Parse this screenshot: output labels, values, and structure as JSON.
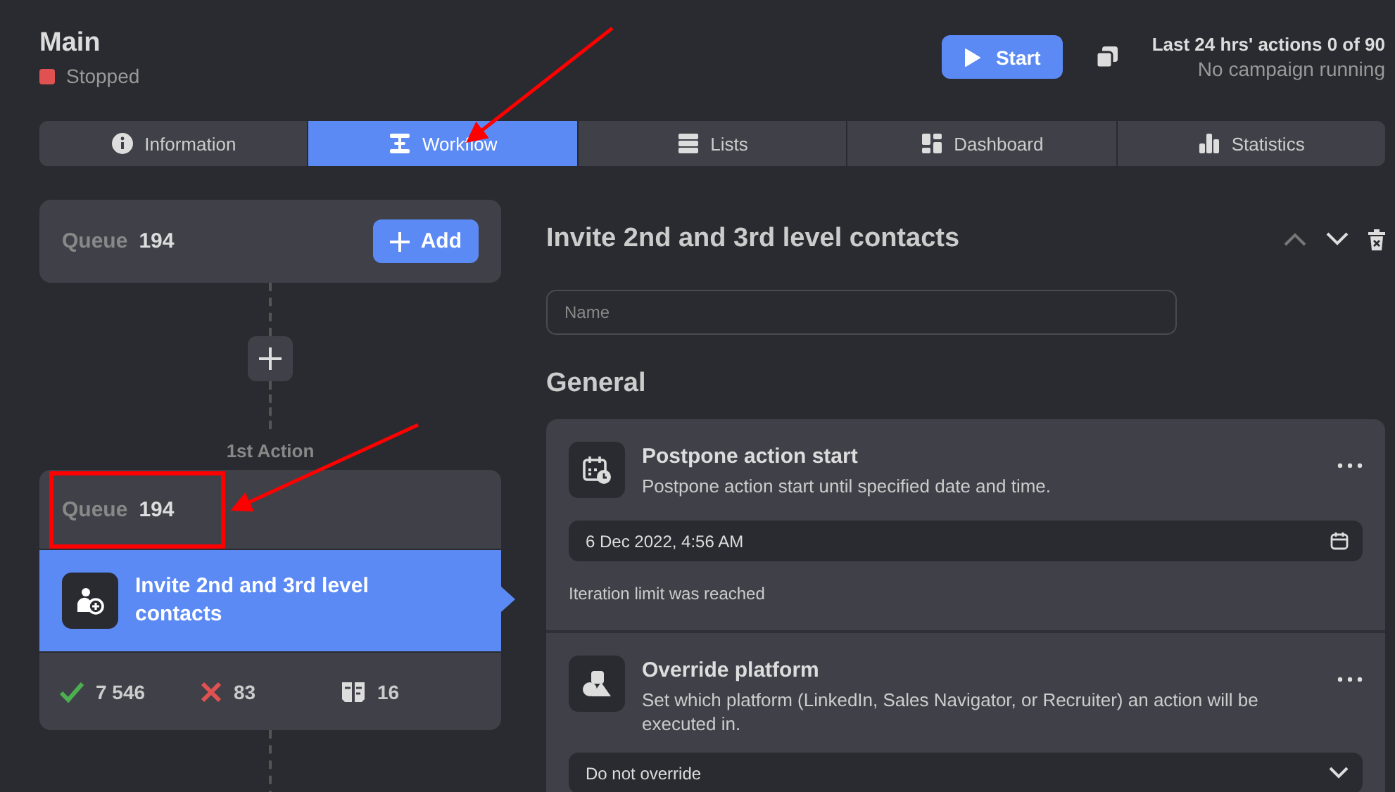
{
  "header": {
    "title": "Main",
    "status": {
      "label": "Stopped",
      "color": "#e05252"
    },
    "start_button": "Start",
    "actions_summary": "Last 24 hrs' actions 0 of 90",
    "campaign_status": "No campaign running"
  },
  "tabs": [
    {
      "label": "Information",
      "selected": false
    },
    {
      "label": "Workflow",
      "selected": true
    },
    {
      "label": "Lists",
      "selected": false
    },
    {
      "label": "Dashboard",
      "selected": false
    },
    {
      "label": "Statistics",
      "selected": false
    }
  ],
  "workflow": {
    "start_node": {
      "queue_label": "Queue",
      "queue_count": "194",
      "add_button": "Add"
    },
    "step_label": "1st Action",
    "action_card": {
      "queue_label": "Queue",
      "queue_count": "194",
      "highlighted": true,
      "title": "Invite 2nd and 3rd level contacts",
      "selected": true,
      "stats": [
        {
          "kind": "success",
          "value": "7 546"
        },
        {
          "kind": "failed",
          "value": "83"
        },
        {
          "kind": "skipped",
          "value": "16"
        }
      ]
    }
  },
  "detail": {
    "title": "Invite 2nd and 3rd level contacts",
    "name_field": {
      "placeholder": "Name"
    },
    "section_title": "General",
    "settings": [
      {
        "kind": "date",
        "title": "Postpone action start",
        "description": "Postpone action start until specified date and time.",
        "value": "6 Dec 2022, 4:56 AM",
        "note": "Iteration limit was reached"
      },
      {
        "kind": "select",
        "title": "Override platform",
        "description": "Set which platform (LinkedIn, Sales Navigator, or Recruiter) an action will be executed in.",
        "value": "Do not override"
      }
    ]
  },
  "annotations": [
    {
      "kind": "arrow"
    },
    {
      "kind": "arrow"
    }
  ]
}
